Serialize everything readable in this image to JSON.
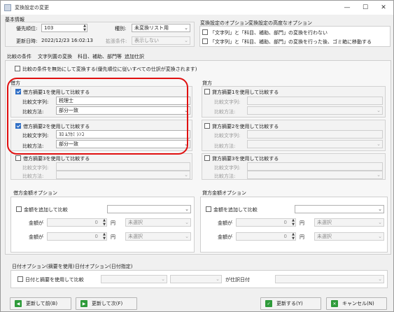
{
  "window": {
    "title": "変換設定の変更",
    "colors": {
      "accent": "#2f6fc6",
      "highlight": "#e01010"
    }
  },
  "basic": {
    "heading": "基本情報",
    "priority_label": "優先順位:",
    "priority_value": "103",
    "kind_label": "種別:",
    "kind_value": "未変換リスト用",
    "updated_label": "更新日時:",
    "updated_value": "2022/12/23 16:02:13",
    "ext_label": "拡張条件:",
    "ext_value": "表示しない"
  },
  "options": {
    "tab1": "変換設定のオプション",
    "tab2": "変換設定の高度なオプション",
    "opt1": "「文字列」と「科目、補助、部門」の変換を行わない",
    "opt2": "「文字列」と「科目、補助、部門」の変換を行った後、ゴミ箱に移動する"
  },
  "tabs": [
    "比較の条件",
    "文字列置の変換",
    "科目、補助、部門等",
    "追加仕訳"
  ],
  "disable_all": "比較の条件を無効にして変換する(優先順位に従いすべての仕訳が変換されます)",
  "debit": {
    "heading": "借方",
    "rows": [
      {
        "check": "借方摘要1を使用して比較する",
        "checked": true,
        "str_label": "比較文字列:",
        "str_value": "税理士",
        "method_label": "比較方法:",
        "method_value": "部分一致"
      },
      {
        "check": "借方摘要2を使用して比較する",
        "checked": true,
        "str_label": "比較文字列:",
        "str_value": "ﾖﾛ ﾑﾗｶﾐ ｼﾝｺ",
        "method_label": "比較方法:",
        "method_value": "部分一致"
      },
      {
        "check": "借方摘要3を使用して比較する",
        "checked": false,
        "str_label": "比較文字列:",
        "str_value": "",
        "method_label": "比較方法:",
        "method_value": ""
      }
    ]
  },
  "credit": {
    "heading": "貸方",
    "rows": [
      {
        "check": "貸方摘要1を使用して比較する",
        "checked": false,
        "str_label": "比較文字列:",
        "method_label": "比較方法:"
      },
      {
        "check": "貸方摘要2を使用して比較する",
        "checked": false,
        "str_label": "比較文字列:",
        "method_label": "比較方法:"
      },
      {
        "check": "貸方摘要3を使用して比較する",
        "checked": false,
        "str_label": "比較文字列:",
        "method_label": "比較方法:"
      }
    ]
  },
  "debit_amount": {
    "heading": "借方金額オプション",
    "check": "金額を追加して比較",
    "amount_label": "金額が",
    "value": "0",
    "unit": "円",
    "cond": "未選択"
  },
  "credit_amount": {
    "heading": "貸方金額オプション",
    "check": "金額を追加して比較",
    "amount_label": "金額が",
    "value": "0",
    "unit": "円",
    "cond": "未選択"
  },
  "date": {
    "tab1": "日付オプション(摘要を使用)",
    "tab2": "日付オプション(日付指定)",
    "check": "日付と摘要を使用して比較",
    "suffix": "が仕訳日付"
  },
  "buttons": {
    "prev": "更新して前(B)",
    "next": "更新して次(F)",
    "update": "更新する(Y)",
    "cancel": "キャンセル(N)"
  }
}
